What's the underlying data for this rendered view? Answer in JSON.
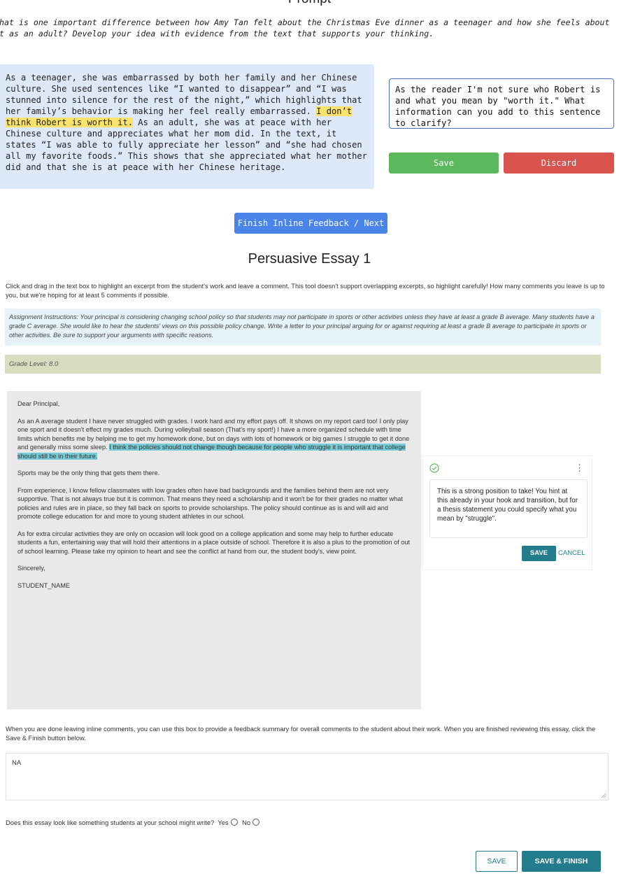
{
  "prompt": {
    "title": "Prompt",
    "question_line1": "What is one important difference between how Amy Tan felt about the Christmas Eve dinner as a teenager and how she feels about",
    "question_line2": "it as an adult? Develop your idea with evidence from the text that supports your thinking."
  },
  "inline_feedback": {
    "essay_before": "As a teenager, she was embarrassed by both her family and her Chinese culture. She used sentences like “I wanted to disappear” and “I was stunned into silence for the rest of the night,” which highlights that her family’s behavior is making her feel really embarrassed. ",
    "essay_highlight": "I don’t think Robert is worth it.",
    "essay_after": " As an adult, she was at peace with her Chinese culture and appreciates what her mom did. In the text, it states “I was able to fully appreciate her lesson” and “she had chosen all my favorite foods.” This shows that she appreciated what her mother did and that she is at peace with her Chinese heritage.",
    "comment_text": "As the reader I'm not sure who Robert is and what you mean by \"worth it.\" What information can you add to this sentence to clarify?",
    "save_label": "Save",
    "discard_label": "Discard",
    "finish_label": "Finish Inline Feedback / Next"
  },
  "essay": {
    "title": "Persuasive Essay 1",
    "instructions": "Click and drag in the text box to highlight an excerpt from the student's work and leave a comment. This tool doesn't support overlapping excerpts, so highlight carefully! How many comments you leave is up to you, but we're hoping for at least 5 comments if possible.",
    "assignment": "Assignment Instructions: Your principal is considering changing school policy so that students may not participate in sports or other activities unless they have at least a grade B average. Many students have a grade C average. She would like to hear the students' views on this possible policy change. Write a letter to your principal arguing for or against requiring at least a grade B average to participate in sports or other activities. Be sure to support your arguments with specific reasons.",
    "grade_level": "Grade Level: 8.0",
    "greeting": "Dear Principal,",
    "p1_before": "As an A average student I have never struggled with grades. I work hard and my effort pays off. It shows on my report card too! I only play one sport and it doesn't effect my grades much. During volleyball season (That's my sport!) I have a more organized schedule with time limits which benefits me by helping me to get my homework done, but on days with lots of homework or big games I struggle to get it done and generally miss some sleep. ",
    "p1_highlight": "I think the policies should not change though because for people who struggle it is important that college should still be in their future.",
    "p2": "Sports may be the only thing that gets them there.",
    "p3": "From experience, I know fellow classmates with low grades often have bad backgrounds and the families behind them are not very supportive. That is not always true but it is common. That means they need a scholarship and it won't be for their grades no matter what policies and rules are in place, so they fall back on sports to provide scholarships. The policy should continue as is and will aid and promote college education for and more to young student athletes in our school.",
    "p4": "As for extra circular activities they are only on occasion will look good on a college application and some may help to further educate students a fun, entertaining way that will hold their attentions in a place outside of school. Therefore it is also a plus to the promotion of out of school learning. Please take my opinion to heart and see the conflict at hand from our, the student body's, view point.",
    "closing": "Sincerely,",
    "signature": "STUDENT_NAME"
  },
  "comment_card": {
    "text": "This is a strong position to take! You hint at this already in your hook and transition, but for a thesis statement you could specify what you mean by \"struggle\".",
    "save_label": "SAVE",
    "cancel_label": "CANCEL",
    "check_icon": "check-circle-icon",
    "menu_icon": "kebab-menu-icon"
  },
  "summary": {
    "help": "When you are done leaving inline comments, you can use this box to provide a feedback summary for overall comments to the student about their work. When you are finished reviewing this essay, click the Save & Finish button below.",
    "value": "NA"
  },
  "question": {
    "text": "Does this essay look like something students at your school might write?",
    "yes_label": "Yes",
    "no_label": "No"
  },
  "actions": {
    "save_label": "SAVE",
    "save_finish_label": "SAVE & FINISH"
  },
  "colors": {
    "accent": "#227c8c",
    "yellow_highlight": "#fbe36b",
    "teal_highlight": "#77cbd6",
    "save_green": "#5cb85c",
    "discard_red": "#d9534f",
    "finish_blue": "#4b84e8"
  }
}
